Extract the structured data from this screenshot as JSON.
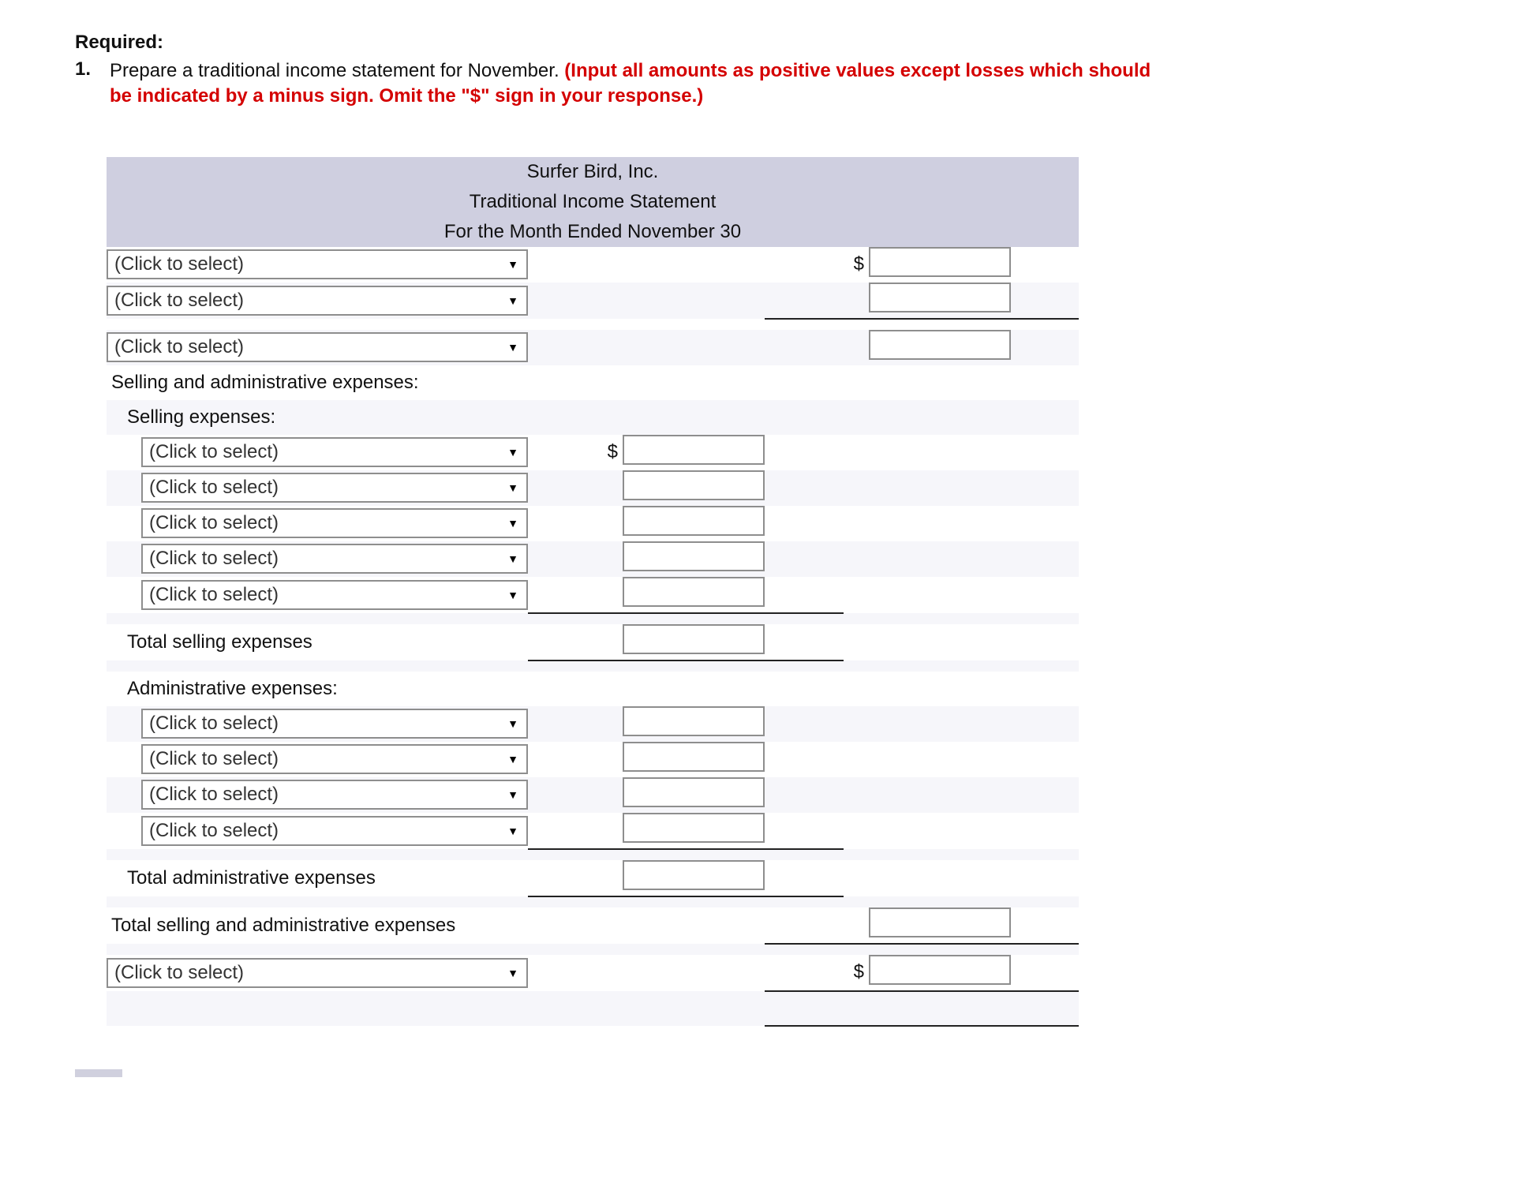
{
  "header": {
    "required_label": "Required:",
    "step_number": "1.",
    "instruction_plain": "Prepare a traditional income statement for November. ",
    "instruction_red": "(Input all amounts as positive values except losses which should be indicated by a minus sign. Omit the \"$\" sign in your response.)"
  },
  "company_name": "Surfer Bird, Inc.",
  "statement_title": "Traditional Income Statement",
  "period_line": "For the Month Ended November 30",
  "select_placeholder": "(Click to select)",
  "labels": {
    "selling_admin_header": "Selling and administrative expenses:",
    "selling_header": "Selling expenses:",
    "total_selling": "Total selling expenses",
    "admin_header": "Administrative expenses:",
    "total_admin": "Total administrative expenses",
    "total_selling_admin": "Total selling and administrative expenses"
  },
  "dollar": "$"
}
